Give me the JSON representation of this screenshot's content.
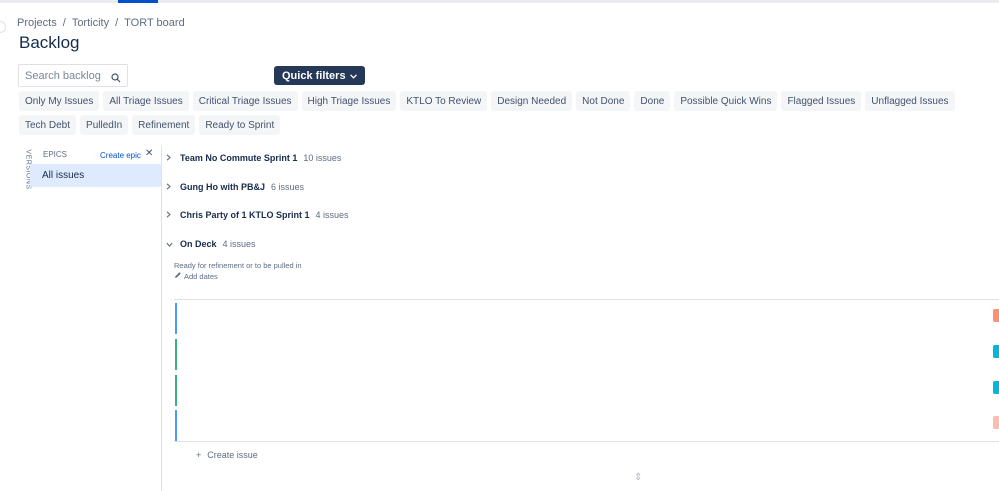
{
  "breadcrumb": {
    "items": [
      "Projects",
      "Torticity",
      "TORT board"
    ],
    "separator": "/"
  },
  "page": {
    "title": "Backlog"
  },
  "search": {
    "placeholder": "Search backlog",
    "icon": "search-icon"
  },
  "quick_filters": {
    "label": "Quick filters",
    "icon": "chevron-down-icon"
  },
  "filters": [
    "Only My Issues",
    "All Triage Issues",
    "Critical Triage Issues",
    "High Triage Issues",
    "KTLO To Review",
    "Design Needed",
    "Not Done",
    "Done",
    "Possible Quick Wins",
    "Flagged Issues",
    "Unflagged Issues",
    "Tech Debt",
    "PulledIn",
    "Refinement",
    "Ready to Sprint"
  ],
  "sidebar": {
    "versions_label": "VERSIONS",
    "epics_label": "EPICS",
    "create_epic_label": "Create epic",
    "close_symbol": "✕",
    "all_issues_label": "All issues"
  },
  "sprints": [
    {
      "name": "Team No Commute Sprint 1",
      "count": "10 issues",
      "expanded": false
    },
    {
      "name": "Gung Ho with PB&J",
      "count": "6 issues",
      "expanded": false
    },
    {
      "name": "Chris Party of 1 KTLO Sprint 1",
      "count": "4 issues",
      "expanded": false
    },
    {
      "name": "On Deck",
      "count": "4 issues",
      "expanded": true
    }
  ],
  "on_deck": {
    "description": "Ready for refinement or to be pulled in",
    "add_dates_label": "Add dates",
    "issues": [
      {
        "stripe_color": "#4c9aff",
        "badge_color": "#ff8f73"
      },
      {
        "stripe_color": "#36b37e",
        "badge_color": "#00b8d9"
      },
      {
        "stripe_color": "#36b37e",
        "badge_color": "#00b8d9"
      },
      {
        "stripe_color": "#4c9aff",
        "badge_color": "#ffbdad"
      }
    ]
  },
  "create_issue": {
    "symbol": "+",
    "label": "Create issue"
  },
  "colors": {
    "accent": "#0052cc",
    "quick_filter_bg": "#253858",
    "selected_bg": "#deebff"
  }
}
